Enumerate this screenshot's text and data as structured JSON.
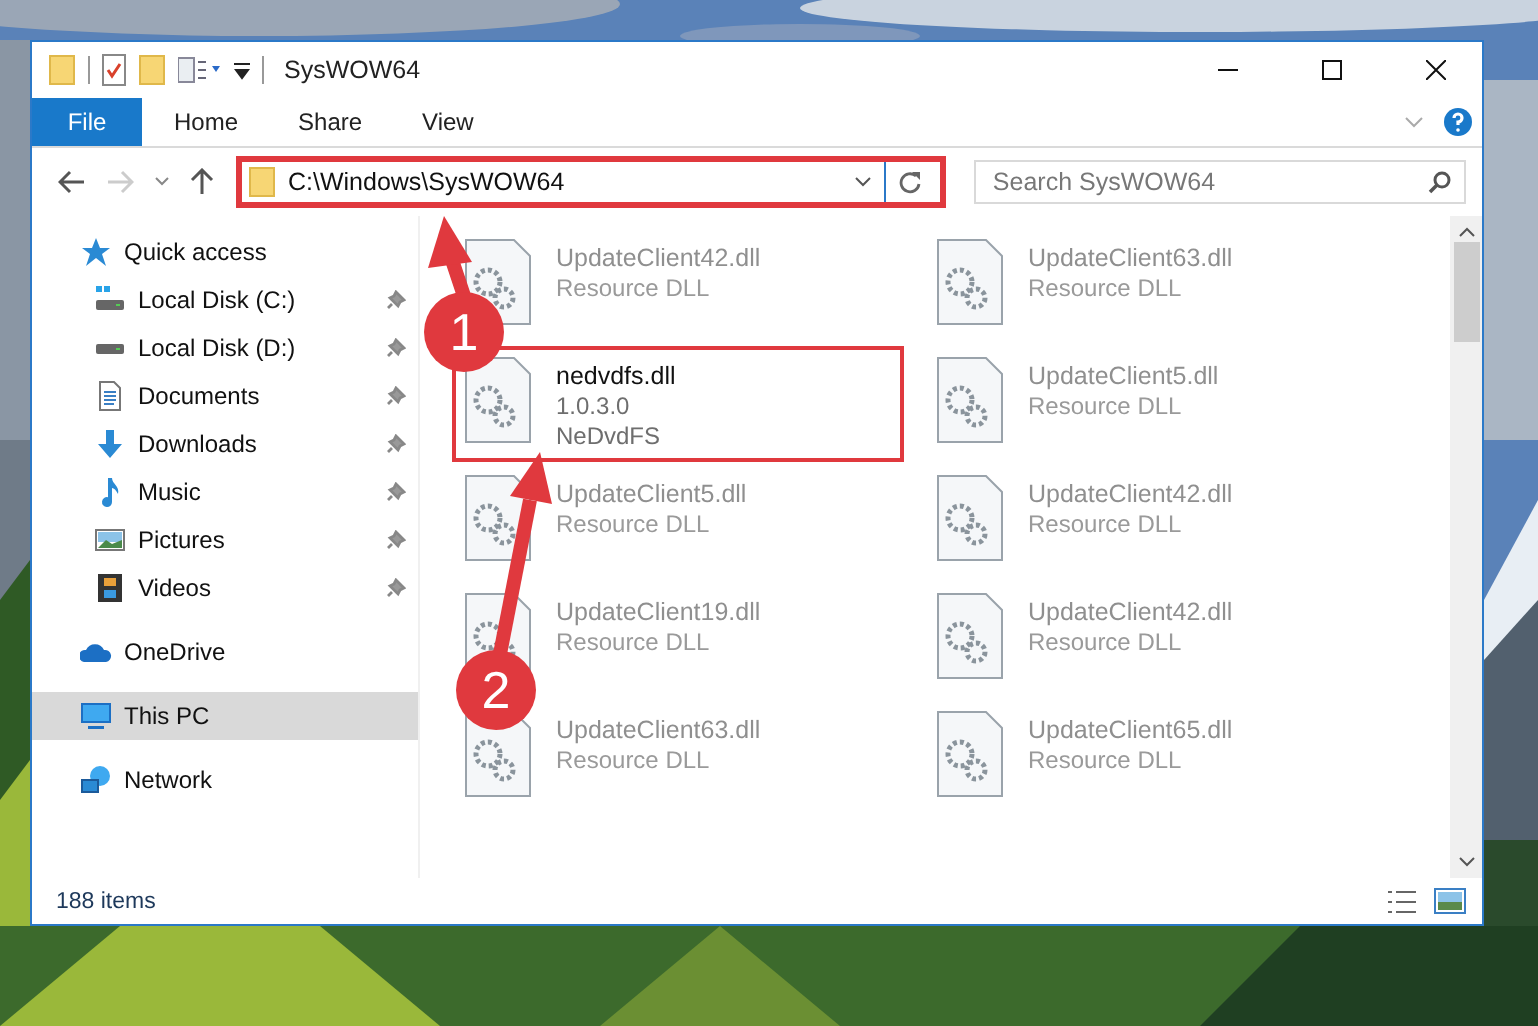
{
  "window": {
    "title": "SysWOW64"
  },
  "ribbon": {
    "file_button": "File",
    "tabs": [
      "Home",
      "Share",
      "View"
    ]
  },
  "address": {
    "path": "C:\\Windows\\SysWOW64",
    "highlighted": true
  },
  "search": {
    "placeholder": "Search SysWOW64"
  },
  "sidebar": {
    "items": [
      {
        "label": "Quick access",
        "kind": "star",
        "selected": false,
        "children": [
          {
            "label": "Local Disk (C:)",
            "kind": "system-drive",
            "selected": false,
            "pinned": true
          },
          {
            "label": "Local Disk (D:)",
            "kind": "drive",
            "selected": false,
            "pinned": true
          },
          {
            "label": "Documents",
            "kind": "document",
            "selected": false,
            "pinned": true
          },
          {
            "label": "Downloads",
            "kind": "download",
            "selected": false,
            "pinned": true
          },
          {
            "label": "Music",
            "kind": "music",
            "selected": false,
            "pinned": true
          },
          {
            "label": "Pictures",
            "kind": "pictures",
            "selected": false,
            "pinned": true
          },
          {
            "label": "Videos",
            "kind": "videos",
            "selected": false,
            "pinned": true
          }
        ]
      },
      {
        "label": "OneDrive",
        "kind": "cloud",
        "selected": false
      },
      {
        "label": "This PC",
        "kind": "computer",
        "selected": true
      },
      {
        "label": "Network",
        "kind": "network",
        "selected": false
      }
    ]
  },
  "files": [
    {
      "name": "UpdateClient42.dll",
      "lines": [
        "Resource DLL"
      ],
      "faded": true,
      "highlighted": false
    },
    {
      "name": "UpdateClient63.dll",
      "lines": [
        "Resource DLL"
      ],
      "faded": true,
      "highlighted": false
    },
    {
      "name": "nedvdfs.dll",
      "lines": [
        "1.0.3.0",
        "NeDvdFS"
      ],
      "faded": false,
      "highlighted": true
    },
    {
      "name": "UpdateClient5.dll",
      "lines": [
        "Resource DLL"
      ],
      "faded": true,
      "highlighted": false
    },
    {
      "name": "UpdateClient5.dll",
      "lines": [
        "Resource DLL"
      ],
      "faded": true,
      "highlighted": false
    },
    {
      "name": "UpdateClient42.dll",
      "lines": [
        "Resource DLL"
      ],
      "faded": true,
      "highlighted": false
    },
    {
      "name": "UpdateClient19.dll",
      "lines": [
        "Resource DLL"
      ],
      "faded": true,
      "highlighted": false
    },
    {
      "name": "UpdateClient42.dll",
      "lines": [
        "Resource DLL"
      ],
      "faded": true,
      "highlighted": false
    },
    {
      "name": "UpdateClient63.dll",
      "lines": [
        "Resource DLL"
      ],
      "faded": true,
      "highlighted": false
    },
    {
      "name": "UpdateClient65.dll",
      "lines": [
        "Resource DLL"
      ],
      "faded": true,
      "highlighted": false
    }
  ],
  "status_bar": {
    "item_count": "188 items"
  },
  "annotations": [
    {
      "number": "1"
    },
    {
      "number": "2"
    }
  ]
}
